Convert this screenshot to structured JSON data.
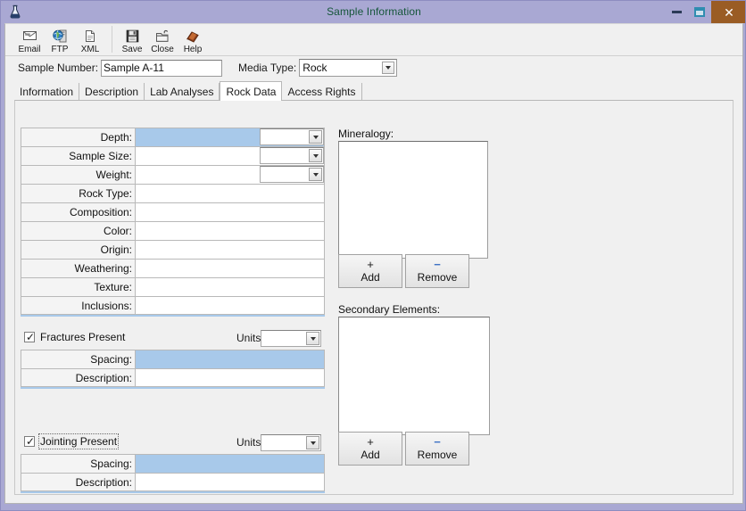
{
  "window": {
    "title": "Sample Information",
    "icon": "flask-icon",
    "controls": {
      "minimize": "minimize-icon",
      "maximize": "maximize-icon",
      "close": "✕"
    },
    "close_color": "#9a5c24",
    "titlebar_color": "#a9a8d3",
    "title_text_color": "#16563a"
  },
  "toolbar": {
    "items": [
      {
        "label": "Email",
        "icon": "email-icon"
      },
      {
        "label": "FTP",
        "icon": "ftp-icon"
      },
      {
        "label": "XML",
        "icon": "xml-icon"
      }
    ],
    "items2": [
      {
        "label": "Save",
        "icon": "save-icon"
      },
      {
        "label": "Close",
        "icon": "close-folder-icon"
      },
      {
        "label": "Help",
        "icon": "help-book-icon"
      }
    ]
  },
  "header": {
    "sample_number_label": "Sample Number:",
    "sample_number_value": "Sample A-11",
    "media_type_label": "Media Type:",
    "media_type_value": "Rock"
  },
  "tabs": [
    {
      "label": "Information",
      "active": false
    },
    {
      "label": "Description",
      "active": false
    },
    {
      "label": "Lab Analyses",
      "active": false
    },
    {
      "label": "Rock Data",
      "active": true
    },
    {
      "label": "Access Rights",
      "active": false
    }
  ],
  "rock_data": {
    "rows": [
      {
        "label": "Depth:",
        "value": "",
        "selected": true,
        "has_units": true
      },
      {
        "label": "Sample Size:",
        "value": "",
        "selected": false,
        "has_units": true
      },
      {
        "label": "Weight:",
        "value": "",
        "selected": false,
        "has_units": true
      },
      {
        "label": "Rock Type:",
        "value": "",
        "selected": false,
        "has_units": false
      },
      {
        "label": "Composition:",
        "value": "",
        "selected": false,
        "has_units": false
      },
      {
        "label": "Color:",
        "value": "",
        "selected": false,
        "has_units": false
      },
      {
        "label": "Origin:",
        "value": "",
        "selected": false,
        "has_units": false
      },
      {
        "label": "Weathering:",
        "value": "",
        "selected": false,
        "has_units": false
      },
      {
        "label": "Texture:",
        "value": "",
        "selected": false,
        "has_units": false
      },
      {
        "label": "Inclusions:",
        "value": "",
        "selected": false,
        "has_units": false
      }
    ]
  },
  "fractures": {
    "checkbox_label": "Fractures Present",
    "checked": true,
    "focused": false,
    "units_label": "Units:",
    "units_value": "",
    "rows": [
      {
        "label": "Spacing:",
        "value": "",
        "selected": true
      },
      {
        "label": "Description:",
        "value": "",
        "selected": false
      }
    ]
  },
  "jointing": {
    "checkbox_label": "Jointing Present",
    "checked": true,
    "focused": true,
    "units_label": "Units:",
    "units_value": "",
    "rows": [
      {
        "label": "Spacing:",
        "value": "",
        "selected": true
      },
      {
        "label": "Description:",
        "value": "",
        "selected": false
      }
    ]
  },
  "mineralogy": {
    "label": "Mineralogy:",
    "items": [],
    "add_symbol": "+",
    "add_label": "Add",
    "remove_symbol": "−",
    "remove_label": "Remove"
  },
  "secondary_elements": {
    "label": "Secondary Elements:",
    "items": [],
    "add_symbol": "+",
    "add_label": "Add",
    "remove_symbol": "−",
    "remove_label": "Remove"
  },
  "colors": {
    "selection_blue": "#a8c9ea",
    "panel_gray": "#f0f0f0",
    "label_gray": "#f4f4f4",
    "minus_blue": "#3f72c4"
  }
}
